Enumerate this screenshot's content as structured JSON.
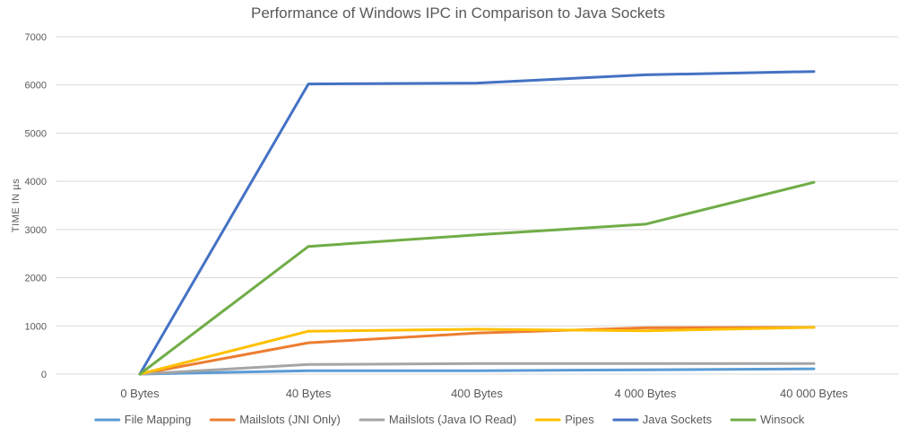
{
  "chart_data": {
    "type": "line",
    "title": "Performance of Windows IPC in Comparison to Java Sockets",
    "xlabel": "",
    "ylabel": "TIME IN µs",
    "categories": [
      "0 Bytes",
      "40 Bytes",
      "400 Bytes",
      "4 000 Bytes",
      "40 000 Bytes"
    ],
    "ylim": [
      0,
      7000
    ],
    "yticks": [
      0,
      1000,
      2000,
      3000,
      4000,
      5000,
      6000,
      7000
    ],
    "grid": true,
    "legend_position": "bottom",
    "series": [
      {
        "name": "File Mapping",
        "color": "#5b9bd5",
        "values": [
          0,
          70,
          70,
          90,
          110
        ]
      },
      {
        "name": "Mailslots (JNI Only)",
        "color": "#ed7d31",
        "values": [
          0,
          650,
          850,
          960,
          970
        ]
      },
      {
        "name": "Mailslots (Java IO Read)",
        "color": "#a5a5a5",
        "values": [
          0,
          200,
          220,
          220,
          220
        ]
      },
      {
        "name": "Pipes",
        "color": "#ffc000",
        "values": [
          0,
          890,
          930,
          900,
          970
        ]
      },
      {
        "name": "Java Sockets",
        "color": "#4472c4",
        "values": [
          0,
          6020,
          6040,
          6210,
          6280
        ]
      },
      {
        "name": "Winsock",
        "color": "#70ad47",
        "values": [
          0,
          2650,
          2890,
          3110,
          3980
        ]
      }
    ]
  }
}
